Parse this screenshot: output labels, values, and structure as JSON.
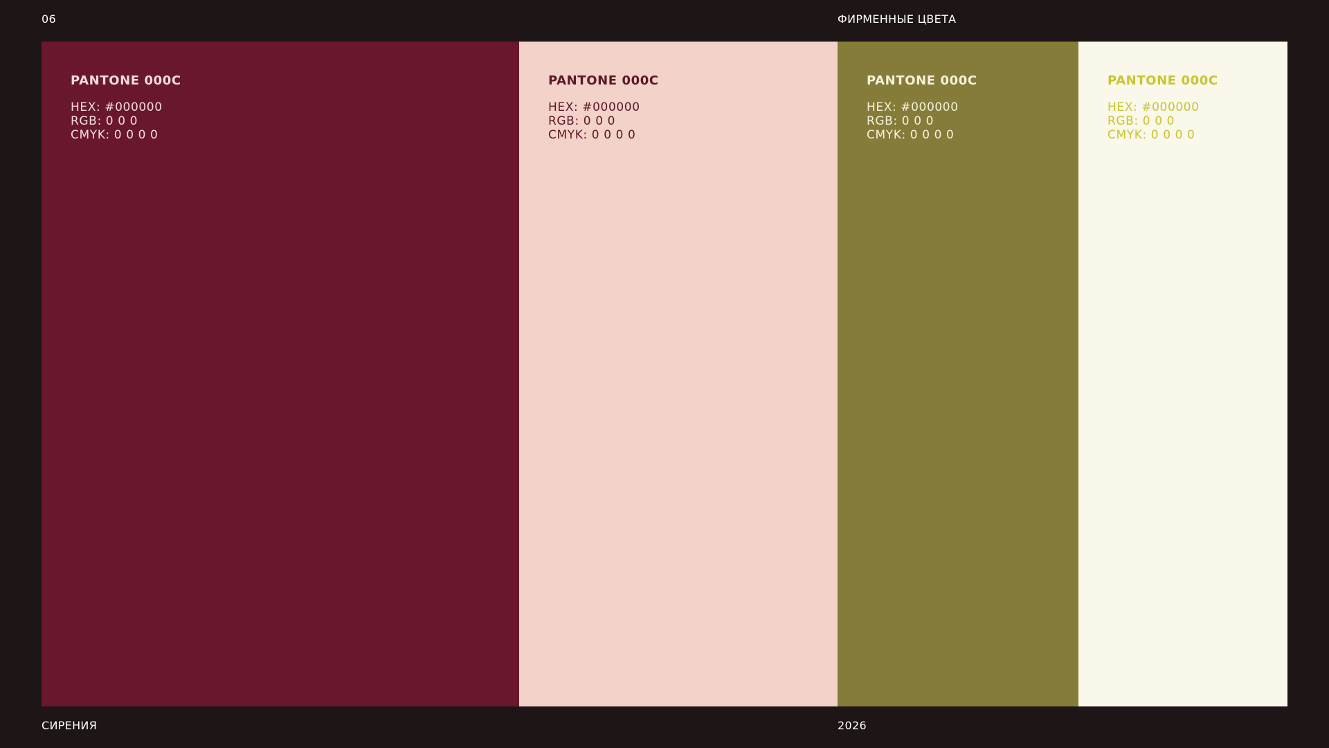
{
  "header": {
    "page_number": "06",
    "section_title": "ФИРМЕННЫЕ ЦВЕТА"
  },
  "footer": {
    "brand": "СИРЕНИЯ",
    "year": "2026"
  },
  "swatches": [
    {
      "pantone": "PANTONE 000C",
      "hex": "HEX: #000000",
      "rgb": "RGB: 0 0 0",
      "cmyk": "CMYK: 0 0 0 0",
      "background_color": "#69172c",
      "text_color": "#f2dcdc"
    },
    {
      "pantone": "PANTONE 000C",
      "hex": "HEX: #000000",
      "rgb": "RGB: 0 0 0",
      "cmyk": "CMYK: 0 0 0 0",
      "background_color": "#f3d2ca",
      "text_color": "#5c1828"
    },
    {
      "pantone": "PANTONE 000C",
      "hex": "HEX: #000000",
      "rgb": "RGB: 0 0 0",
      "cmyk": "CMYK: 0 0 0 0",
      "background_color": "#847c38",
      "text_color": "#f6f1dc"
    },
    {
      "pantone": "PANTONE 000C",
      "hex": "HEX: #000000",
      "rgb": "RGB: 0 0 0",
      "cmyk": "CMYK: 0 0 0 0",
      "background_color": "#f9f8ea",
      "text_color": "#c9c52e"
    }
  ]
}
